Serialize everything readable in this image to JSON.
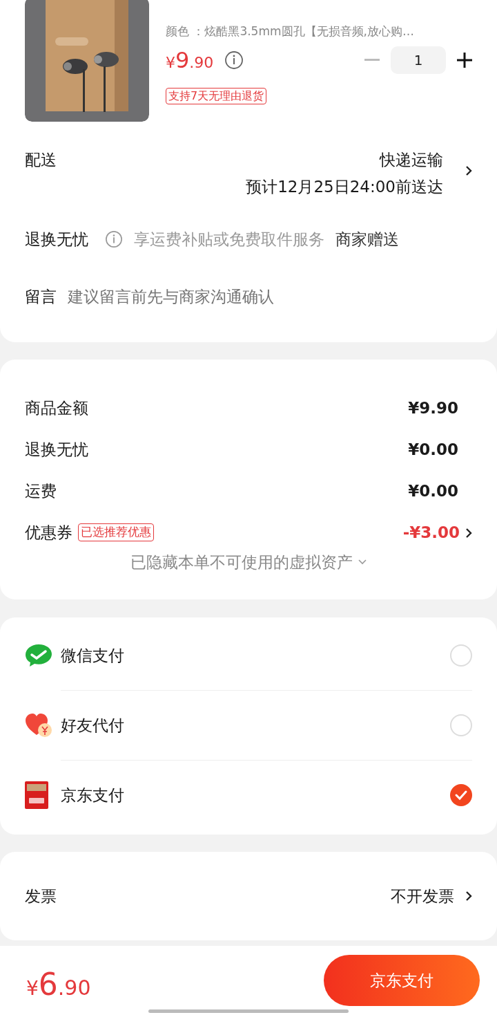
{
  "product": {
    "spec": "颜色 ：炫酷黑3.5mm圆孔【无损音频,放心购…",
    "currency": "¥",
    "price_main": "9",
    "price_cents": ".90",
    "quantity": "1",
    "tags": [
      "支持7天无理由退货"
    ]
  },
  "delivery": {
    "label": "配送",
    "method": "快递运输",
    "eta": "预计12月25日24:00前送达"
  },
  "returns": {
    "label": "退换无忧",
    "description": "享运费补贴或免费取件服务",
    "note": "商家赠送"
  },
  "message": {
    "label": "留言",
    "placeholder": "建议留言前先与商家沟通确认"
  },
  "summary": {
    "rows": [
      {
        "kind": "plain",
        "label": "商品金额",
        "value": "¥9.90"
      },
      {
        "kind": "plain",
        "label": "退换无忧",
        "value": "¥0.00"
      },
      {
        "kind": "plain",
        "label": "运费",
        "value": "¥0.00"
      },
      {
        "kind": "discount",
        "label": "优惠券",
        "tag": "已选推荐优惠",
        "value": "-¥3.00"
      }
    ],
    "hidden_note": "已隐藏本单不可使用的虚拟资产"
  },
  "payment_methods": [
    {
      "kind": "wechat",
      "name": "微信支付",
      "selected": false
    },
    {
      "kind": "friend",
      "name": "好友代付",
      "selected": false
    },
    {
      "kind": "jd",
      "name": "京东支付",
      "selected": true
    }
  ],
  "invoice": {
    "label": "发票",
    "value": "不开发票"
  },
  "footer": {
    "currency": "¥",
    "total_main": "6",
    "total_cents": ".90",
    "pay_button": "京东支付"
  }
}
